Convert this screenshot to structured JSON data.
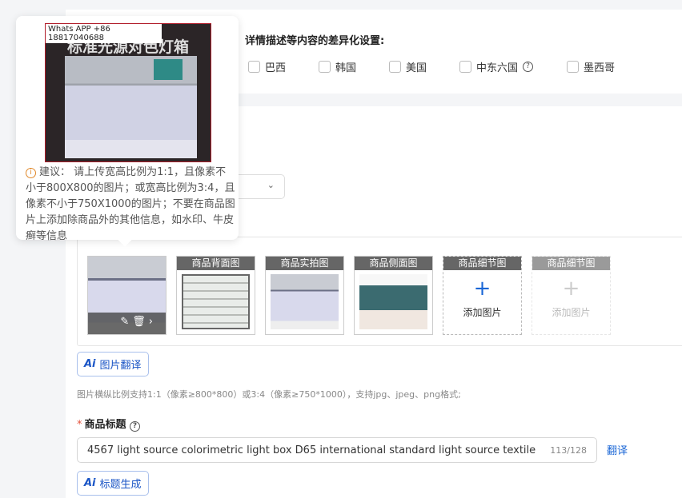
{
  "differentiation": {
    "title": "详情描述等内容的差异化设置:",
    "countries": [
      "巴西",
      "韩国",
      "美国",
      "中东六国",
      "墨西哥"
    ]
  },
  "popover": {
    "watermark": "Whats APP +86 18817040688",
    "image_heading": "标准光源对色灯箱",
    "tip_label": "建议：",
    "tip_text": "请上传宽高比例为1:1，且像素不小于800X800的图片；或宽高比例为3:4，且像素不小于750X1000的图片；不要在商品图片上添加除商品外的其他信息，如水印、牛皮癣等信息"
  },
  "images": {
    "slots": [
      {
        "label": "商品背面图"
      },
      {
        "label": "商品实拍图"
      },
      {
        "label": "商品侧面图"
      },
      {
        "label": "商品细节图",
        "add": "添加图片"
      },
      {
        "label": "商品细节图",
        "add": "添加图片"
      }
    ],
    "tools": "✎🗑›"
  },
  "ai_translate": {
    "badge": "Ai",
    "label": "图片翻译"
  },
  "hint": "图片横纵比例支持1:1（像素≥800*800）或3:4（像素≥750*1000），支持jpg、jpeg、png格式;",
  "title_field": {
    "required": "*",
    "label": "商品标题",
    "value": "4567 light source colorimetric light box D65 international standard light source textile printi",
    "count": "113/128",
    "translate": "翻译"
  },
  "ai_title": {
    "badge": "Ai",
    "label": "标题生成"
  }
}
